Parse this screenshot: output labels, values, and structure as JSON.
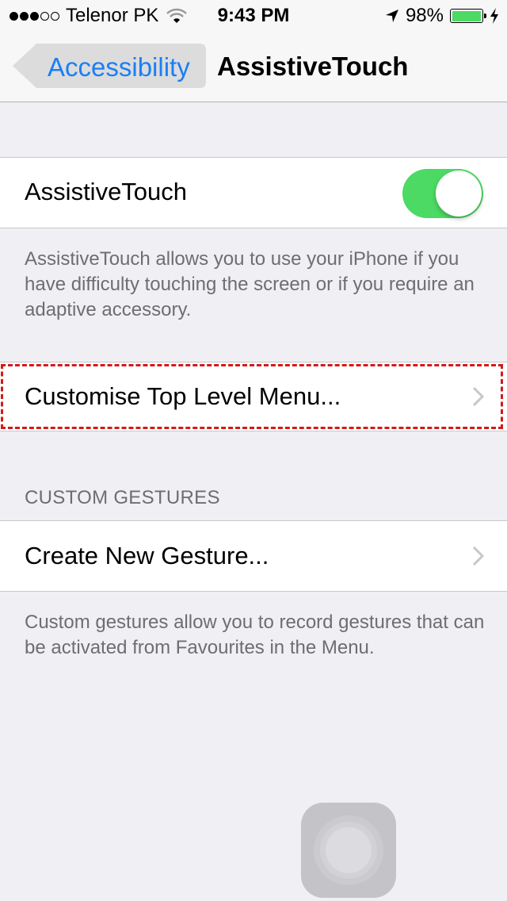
{
  "status_bar": {
    "signal_filled": 3,
    "signal_total": 5,
    "carrier": "Telenor PK",
    "time": "9:43 PM",
    "battery_percent_label": "98%",
    "battery_level": 0.98,
    "icons": [
      "wifi-icon",
      "location-arrow-icon",
      "battery-icon",
      "charging-bolt-icon"
    ]
  },
  "nav": {
    "back_label": "Accessibility",
    "title": "AssistiveTouch",
    "accent_color": "#1a7ff5"
  },
  "assistive_touch": {
    "label": "AssistiveTouch",
    "enabled": true,
    "toggle_color": "#4cd964",
    "footer": "AssistiveTouch allows you to use your iPhone if you have difficulty touching the screen or if you require an adaptive accessory."
  },
  "customise_menu": {
    "label": "Customise Top Level Menu...",
    "highlighted": true,
    "highlight_color": "#d41a1a"
  },
  "custom_gestures": {
    "header": "CUSTOM GESTURES",
    "create_label": "Create New Gesture...",
    "footer": "Custom gestures allow you to record gestures that can be activated from Favourites in the Menu."
  },
  "floating_button": {
    "icon": "assistive-touch-icon"
  }
}
